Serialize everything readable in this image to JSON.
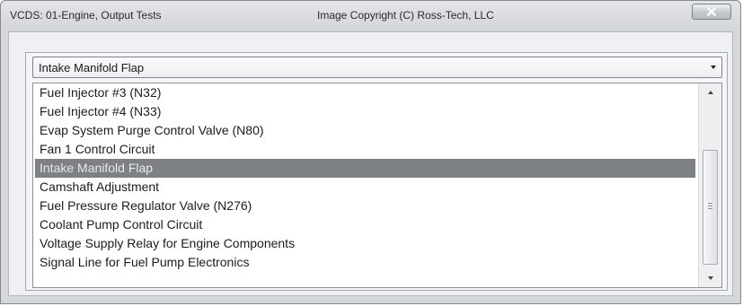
{
  "window": {
    "title": "VCDS: 01-Engine,  Output Tests",
    "copyright": "Image Copyright (C) Ross-Tech, LLC"
  },
  "combo": {
    "selected": "Intake Manifold Flap"
  },
  "list": {
    "items": [
      {
        "label": "Fuel Injector #3 (N32)",
        "selected": false
      },
      {
        "label": "Fuel Injector #4 (N33)",
        "selected": false
      },
      {
        "label": "Evap System Purge Control Valve (N80)",
        "selected": false
      },
      {
        "label": "Fan 1 Control Circuit",
        "selected": false
      },
      {
        "label": "Intake Manifold Flap",
        "selected": true
      },
      {
        "label": "Camshaft Adjustment",
        "selected": false
      },
      {
        "label": "Fuel Pressure Regulator Valve (N276)",
        "selected": false
      },
      {
        "label": "Coolant Pump Control Circuit",
        "selected": false
      },
      {
        "label": "Voltage Supply Relay for Engine Components",
        "selected": false
      },
      {
        "label": "Signal Line for Fuel Pump Electronics",
        "selected": false
      }
    ]
  },
  "icons": {
    "close": "close-icon",
    "combo_dropdown": "chevron-down-icon",
    "scroll_up": "scroll-up-icon",
    "scroll_down": "scroll-down-icon"
  },
  "colors": {
    "selection_background": "#7d8085",
    "selection_text": "#e8e8e8",
    "window_frame": "#d4d7db"
  }
}
